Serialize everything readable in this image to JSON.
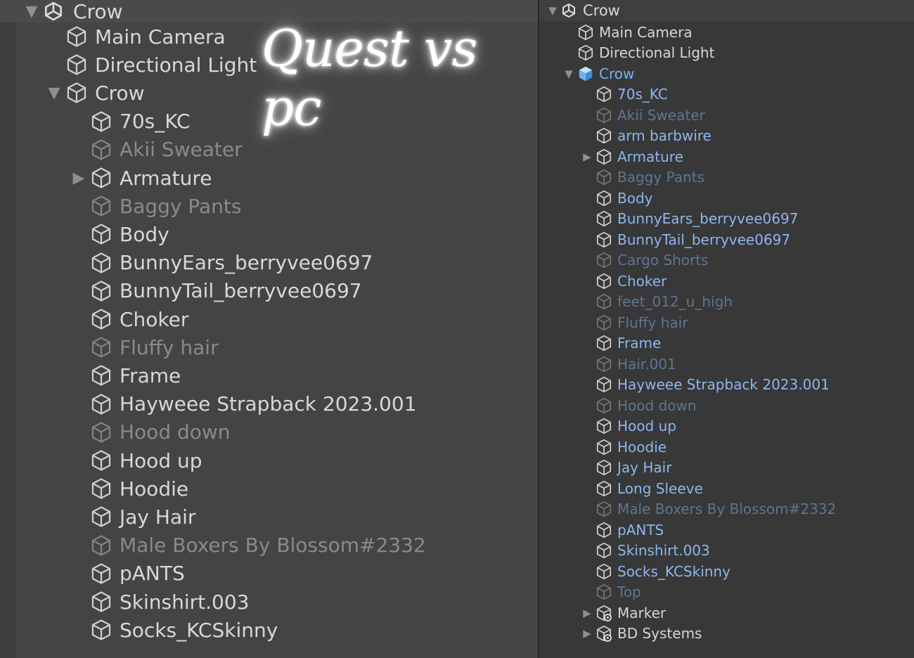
{
  "overlay": {
    "text": "Quest vs pc"
  },
  "colors": {
    "left_bg": "#444444",
    "right_bg": "#383838",
    "prefab_blue": "#8db6ee",
    "selected_blue": "#6fb2ff"
  },
  "quest": {
    "header": {
      "name": "Crow",
      "icon": "unity-logo-icon",
      "expanded": true
    },
    "rows": [
      {
        "name": "Main Camera",
        "depth": 0,
        "active": true,
        "icon": "gameobject-cube-icon"
      },
      {
        "name": "Directional Light",
        "depth": 0,
        "active": true,
        "icon": "gameobject-cube-icon"
      },
      {
        "name": "Crow",
        "depth": 0,
        "active": true,
        "expandable": true,
        "expanded": true,
        "icon": "gameobject-cube-icon"
      },
      {
        "name": "70s_KC",
        "depth": 1,
        "active": true,
        "icon": "gameobject-cube-icon"
      },
      {
        "name": "Akii Sweater",
        "depth": 1,
        "active": false,
        "icon": "gameobject-cube-icon"
      },
      {
        "name": "Armature",
        "depth": 1,
        "active": true,
        "expandable": true,
        "expanded": false,
        "icon": "gameobject-cube-icon"
      },
      {
        "name": "Baggy Pants",
        "depth": 1,
        "active": false,
        "icon": "gameobject-cube-icon"
      },
      {
        "name": "Body",
        "depth": 1,
        "active": true,
        "icon": "gameobject-cube-icon"
      },
      {
        "name": "BunnyEars_berryvee0697",
        "depth": 1,
        "active": true,
        "icon": "gameobject-cube-icon"
      },
      {
        "name": "BunnyTail_berryvee0697",
        "depth": 1,
        "active": true,
        "icon": "gameobject-cube-icon"
      },
      {
        "name": "Choker",
        "depth": 1,
        "active": true,
        "icon": "gameobject-cube-icon"
      },
      {
        "name": "Fluffy hair",
        "depth": 1,
        "active": false,
        "icon": "gameobject-cube-icon"
      },
      {
        "name": "Frame",
        "depth": 1,
        "active": true,
        "icon": "gameobject-cube-icon"
      },
      {
        "name": "Hayweee Strapback 2023.001",
        "depth": 1,
        "active": true,
        "icon": "gameobject-cube-icon"
      },
      {
        "name": "Hood down",
        "depth": 1,
        "active": false,
        "icon": "gameobject-cube-icon"
      },
      {
        "name": "Hood up",
        "depth": 1,
        "active": true,
        "icon": "gameobject-cube-icon"
      },
      {
        "name": "Hoodie",
        "depth": 1,
        "active": true,
        "icon": "gameobject-cube-icon"
      },
      {
        "name": "Jay Hair",
        "depth": 1,
        "active": true,
        "icon": "gameobject-cube-icon"
      },
      {
        "name": "Male Boxers By Blossom#2332",
        "depth": 1,
        "active": false,
        "icon": "gameobject-cube-icon"
      },
      {
        "name": "pANTS",
        "depth": 1,
        "active": true,
        "icon": "gameobject-cube-icon"
      },
      {
        "name": "Skinshirt.003",
        "depth": 1,
        "active": true,
        "icon": "gameobject-cube-icon"
      },
      {
        "name": "Socks_KCSkinny",
        "depth": 1,
        "active": true,
        "icon": "gameobject-cube-icon"
      }
    ]
  },
  "pc": {
    "header": {
      "name": "Crow",
      "icon": "unity-logo-icon",
      "expanded": true
    },
    "rows": [
      {
        "name": "Main Camera",
        "depth": 0,
        "active": true,
        "icon": "gameobject-cube-icon"
      },
      {
        "name": "Directional Light",
        "depth": 0,
        "active": true,
        "icon": "gameobject-cube-icon"
      },
      {
        "name": "Crow",
        "depth": 0,
        "active": true,
        "expandable": true,
        "expanded": true,
        "selected": true,
        "icon": "prefab-cube-icon"
      },
      {
        "name": "70s_KC",
        "depth": 1,
        "active": true,
        "prefab": true,
        "icon": "gameobject-cube-icon"
      },
      {
        "name": "Akii Sweater",
        "depth": 1,
        "active": false,
        "prefab": true,
        "icon": "gameobject-cube-icon"
      },
      {
        "name": "arm barbwire",
        "depth": 1,
        "active": true,
        "prefab": true,
        "icon": "gameobject-cube-icon"
      },
      {
        "name": "Armature",
        "depth": 1,
        "active": true,
        "prefab": true,
        "expandable": true,
        "expanded": false,
        "icon": "gameobject-cube-icon"
      },
      {
        "name": "Baggy Pants",
        "depth": 1,
        "active": false,
        "prefab": true,
        "icon": "gameobject-cube-icon"
      },
      {
        "name": "Body",
        "depth": 1,
        "active": true,
        "prefab": true,
        "icon": "gameobject-cube-icon"
      },
      {
        "name": "BunnyEars_berryvee0697",
        "depth": 1,
        "active": true,
        "prefab": true,
        "icon": "gameobject-cube-icon"
      },
      {
        "name": "BunnyTail_berryvee0697",
        "depth": 1,
        "active": true,
        "prefab": true,
        "icon": "gameobject-cube-icon"
      },
      {
        "name": "Cargo Shorts",
        "depth": 1,
        "active": false,
        "prefab": true,
        "icon": "gameobject-cube-icon"
      },
      {
        "name": "Choker",
        "depth": 1,
        "active": true,
        "prefab": true,
        "icon": "gameobject-cube-icon"
      },
      {
        "name": "feet_012_u_high",
        "depth": 1,
        "active": false,
        "prefab": true,
        "icon": "gameobject-cube-icon"
      },
      {
        "name": "Fluffy hair",
        "depth": 1,
        "active": false,
        "prefab": true,
        "icon": "gameobject-cube-icon"
      },
      {
        "name": "Frame",
        "depth": 1,
        "active": true,
        "prefab": true,
        "icon": "gameobject-cube-icon"
      },
      {
        "name": "Hair.001",
        "depth": 1,
        "active": false,
        "prefab": true,
        "icon": "gameobject-cube-icon"
      },
      {
        "name": "Hayweee Strapback 2023.001",
        "depth": 1,
        "active": true,
        "prefab": true,
        "icon": "gameobject-cube-icon"
      },
      {
        "name": "Hood down",
        "depth": 1,
        "active": false,
        "prefab": true,
        "icon": "gameobject-cube-icon"
      },
      {
        "name": "Hood up",
        "depth": 1,
        "active": true,
        "prefab": true,
        "icon": "gameobject-cube-icon"
      },
      {
        "name": "Hoodie",
        "depth": 1,
        "active": true,
        "prefab": true,
        "icon": "gameobject-cube-icon"
      },
      {
        "name": "Jay Hair",
        "depth": 1,
        "active": true,
        "prefab": true,
        "icon": "gameobject-cube-icon"
      },
      {
        "name": "Long Sleeve",
        "depth": 1,
        "active": true,
        "prefab": true,
        "icon": "gameobject-cube-icon"
      },
      {
        "name": "Male Boxers By Blossom#2332",
        "depth": 1,
        "active": false,
        "prefab": true,
        "icon": "gameobject-cube-icon"
      },
      {
        "name": "pANTS",
        "depth": 1,
        "active": true,
        "prefab": true,
        "icon": "gameobject-cube-icon"
      },
      {
        "name": "Skinshirt.003",
        "depth": 1,
        "active": true,
        "prefab": true,
        "icon": "gameobject-cube-icon"
      },
      {
        "name": "Socks_KCSkinny",
        "depth": 1,
        "active": true,
        "prefab": true,
        "icon": "gameobject-cube-icon"
      },
      {
        "name": "Top",
        "depth": 1,
        "active": false,
        "prefab": true,
        "icon": "gameobject-cube-icon"
      },
      {
        "name": "Marker",
        "depth": 1,
        "active": true,
        "expandable": true,
        "expanded": false,
        "icon": "gameobject-settings-icon"
      },
      {
        "name": "BD Systems",
        "depth": 1,
        "active": true,
        "expandable": true,
        "expanded": false,
        "icon": "gameobject-settings-icon"
      }
    ]
  }
}
